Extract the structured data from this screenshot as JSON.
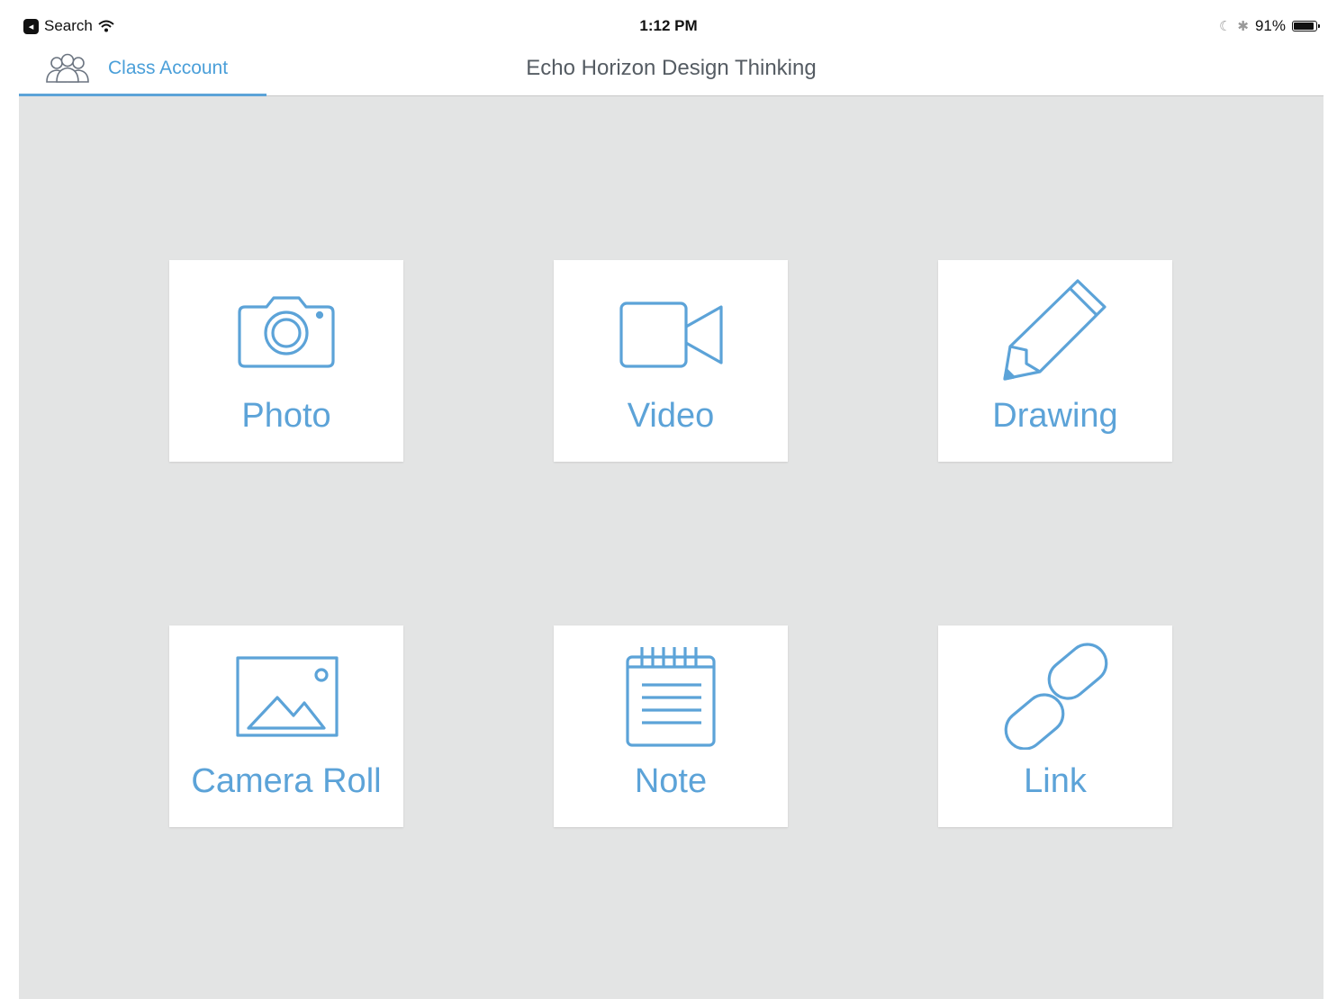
{
  "status_bar": {
    "back_app": "Search",
    "time": "1:12 PM",
    "battery": "91%",
    "battery_level": 0.91
  },
  "nav": {
    "account_label": "Class Account",
    "title": "Echo Horizon Design Thinking"
  },
  "tiles": [
    {
      "label": "Photo",
      "icon": "camera-icon"
    },
    {
      "label": "Video",
      "icon": "video-camera-icon"
    },
    {
      "label": "Drawing",
      "icon": "pencil-icon"
    },
    {
      "label": "Camera Roll",
      "icon": "image-icon"
    },
    {
      "label": "Note",
      "icon": "notepad-icon"
    },
    {
      "label": "Link",
      "icon": "link-icon"
    }
  ],
  "colors": {
    "accent": "#5ca3d8",
    "background": "#e3e4e4",
    "tile": "#ffffff"
  }
}
